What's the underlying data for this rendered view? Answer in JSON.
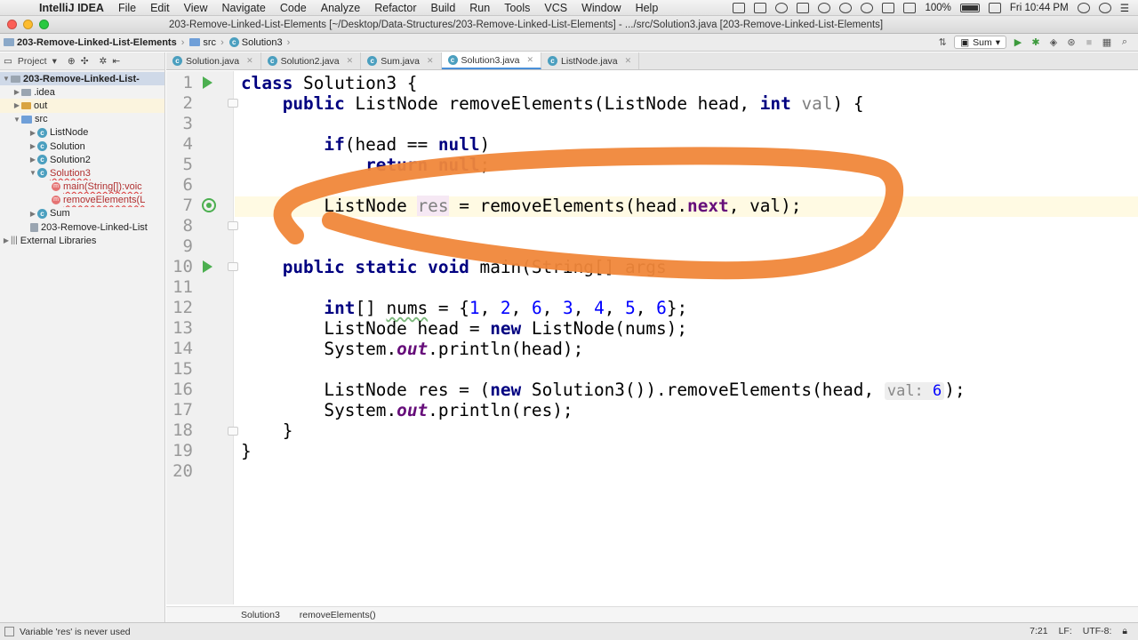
{
  "menubar": {
    "app_name": "IntelliJ IDEA",
    "items": [
      "File",
      "Edit",
      "View",
      "Navigate",
      "Code",
      "Analyze",
      "Refactor",
      "Build",
      "Run",
      "Tools",
      "VCS",
      "Window",
      "Help"
    ],
    "battery": "100%",
    "clock": "Fri 10:44 PM"
  },
  "window": {
    "title": "203-Remove-Linked-List-Elements [~/Desktop/Data-Structures/203-Remove-Linked-List-Elements] - .../src/Solution3.java [203-Remove-Linked-List-Elements]"
  },
  "navbar": {
    "crumbs": [
      "203-Remove-Linked-List-Elements",
      "src",
      "Solution3"
    ],
    "run_config": "Sum"
  },
  "project": {
    "header": "Project",
    "tree": [
      {
        "label": "203-Remove-Linked-List-"
      },
      {
        "label": ".idea"
      },
      {
        "label": "out"
      },
      {
        "label": "src"
      },
      {
        "label": "ListNode"
      },
      {
        "label": "Solution"
      },
      {
        "label": "Solution2"
      },
      {
        "label": "Solution3"
      },
      {
        "label": "main(String[]):voic"
      },
      {
        "label": "removeElements(L"
      },
      {
        "label": "Sum"
      },
      {
        "label": "203-Remove-Linked-List"
      },
      {
        "label": "External Libraries"
      }
    ]
  },
  "tabs": [
    "Solution.java",
    "Solution2.java",
    "Sum.java",
    "Solution3.java",
    "ListNode.java"
  ],
  "editor": {
    "line_numbers": [
      "1",
      "2",
      "3",
      "4",
      "5",
      "6",
      "7",
      "8",
      "9",
      "10",
      "11",
      "12",
      "13",
      "14",
      "15",
      "16",
      "17",
      "18",
      "19",
      "20"
    ],
    "code": {
      "l1_kw": "class",
      "l1_rest": " Solution3 {",
      "l2_kw": "public",
      "l2_a": " ListNode removeElements(ListNode head, ",
      "l2_kw2": "int",
      "l2_b": " ",
      "l2_param": "val",
      "l2_c": ") {",
      "l4_kw": "if",
      "l4_a": "(head == ",
      "l4_kw2": "null",
      "l4_b": ")",
      "l5_kw": "return",
      "l5_a": " ",
      "l5_kw2": "null",
      "l5_b": ";",
      "l7_a": "ListNode ",
      "l7_var": "res",
      "l7_b": " = removeElements(head.",
      "l7_fld": "next",
      "l7_c": ", val);",
      "l10_kw": "public static void",
      "l10_a": " main(String[] args",
      "l12_kw": "int",
      "l12_a": "[] ",
      "l12_var": "nums",
      "l12_b": " = {",
      "l12_n1": "1",
      "l12_n2": "2",
      "l12_n3": "6",
      "l12_n4": "3",
      "l12_n5": "4",
      "l12_n6": "5",
      "l12_n7": "6",
      "l12_c": "};",
      "l13_a": "ListNode head = ",
      "l13_kw": "new",
      "l13_b": " ListNode(nums);",
      "l14_a": "System.",
      "l14_fld": "out",
      "l14_b": ".println(head);",
      "l16_a": "ListNode res = (",
      "l16_kw": "new",
      "l16_b": " Solution3()).removeElements(head, ",
      "l16_hint": "val:",
      "l16_hint_val": "6",
      "l16_c": ");",
      "l17_a": "System.",
      "l17_fld": "out",
      "l17_b": ".println(res);",
      "l18": "}",
      "l19": "}"
    }
  },
  "editor_crumbs": [
    "Solution3",
    "removeElements()"
  ],
  "status": {
    "message": "Variable 'res' is never used",
    "position": "7:21",
    "line_sep": "LF:",
    "encoding": "UTF-8:"
  },
  "colors": {
    "annotation_stroke": "#f0873a",
    "keyword": "#000080",
    "number": "#0000ff",
    "field": "#660e7a",
    "run_green": "#4caf50"
  }
}
